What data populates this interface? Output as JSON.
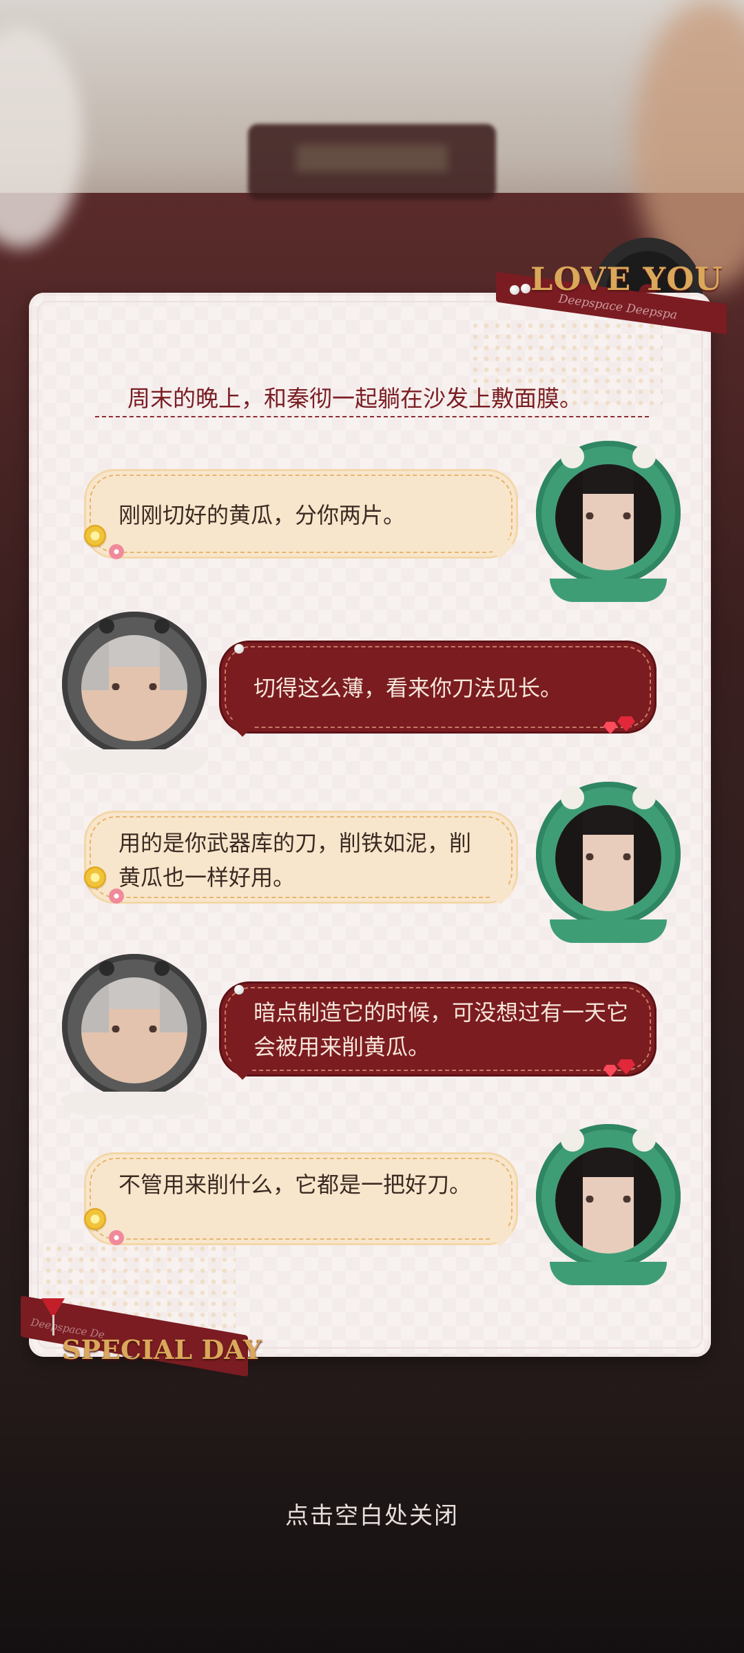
{
  "letter": {
    "header_text": "周末的晚上，和秦彻一起躺在沙发上敷面膜。",
    "ribbon_top": {
      "title": "LOVE YOU",
      "subtitle": "Deepspace Deepspa"
    },
    "ribbon_bottom": {
      "title": "SPECIAL DAY",
      "subtitle": "Deepspace De"
    }
  },
  "messages": [
    {
      "speaker": "her",
      "text": "刚刚切好的黄瓜，分你两片。"
    },
    {
      "speaker": "him",
      "text": "切得这么薄，看来你刀法见长。"
    },
    {
      "speaker": "her",
      "text": "用的是你武器库的刀，削铁如泥，削黄瓜也一样好用。"
    },
    {
      "speaker": "him",
      "text": "暗点制造它的时候，可没想过有一天它会被用来削黄瓜。"
    },
    {
      "speaker": "her",
      "text": "不管用来削什么，它都是一把好刀。"
    }
  ],
  "footer": {
    "close_hint": "点击空白处关闭"
  },
  "colors": {
    "accent_red": "#7b1c20",
    "bubble_her": "#f8e6cc",
    "avatar_her_frame": "#3f9d76",
    "avatar_him_frame": "#5a5a5a",
    "ribbon_gold": "#d9a85a"
  },
  "icons": {
    "her_avatar": "dinosaur-hood-avatar",
    "him_avatar": "penguin-hood-avatar",
    "coin": "coin-badge-icon",
    "flower": "flower-badge-icon",
    "gem": "ruby-gem-icon"
  }
}
